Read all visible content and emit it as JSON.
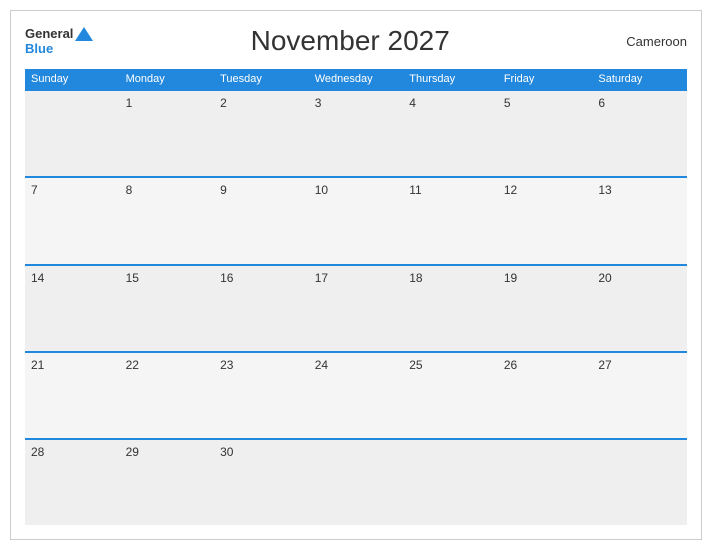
{
  "header": {
    "logo_general": "General",
    "logo_blue": "Blue",
    "title": "November 2027",
    "country": "Cameroon"
  },
  "weekdays": [
    "Sunday",
    "Monday",
    "Tuesday",
    "Wednesday",
    "Thursday",
    "Friday",
    "Saturday"
  ],
  "weeks": [
    [
      "",
      "1",
      "2",
      "3",
      "4",
      "5",
      "6"
    ],
    [
      "7",
      "8",
      "9",
      "10",
      "11",
      "12",
      "13"
    ],
    [
      "14",
      "15",
      "16",
      "17",
      "18",
      "19",
      "20"
    ],
    [
      "21",
      "22",
      "23",
      "24",
      "25",
      "26",
      "27"
    ],
    [
      "28",
      "29",
      "30",
      "",
      "",
      "",
      ""
    ]
  ]
}
